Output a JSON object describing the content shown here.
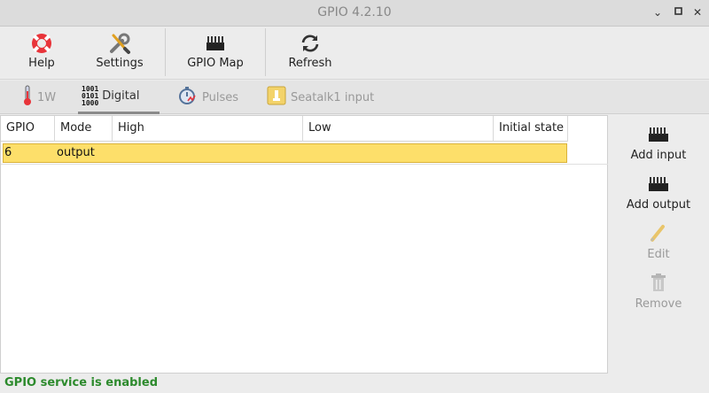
{
  "window": {
    "title": "GPIO 4.2.10"
  },
  "toolbar": {
    "help_label": "Help",
    "settings_label": "Settings",
    "gpio_map_label": "GPIO Map",
    "refresh_label": "Refresh"
  },
  "tabs": [
    {
      "label": "1W",
      "active": false,
      "icon": "thermometer-icon"
    },
    {
      "label": "Digital",
      "active": true,
      "icon": "binary-icon"
    },
    {
      "label": "Pulses",
      "active": false,
      "icon": "stopwatch-icon"
    },
    {
      "label": "Seatalk1 input",
      "active": false,
      "icon": "seatalk-icon"
    }
  ],
  "table": {
    "columns": [
      "GPIO",
      "Mode",
      "High",
      "Low",
      "Initial state"
    ],
    "rows": [
      {
        "gpio": "6",
        "mode": "output",
        "high": "",
        "low": "",
        "initial_state": ""
      }
    ]
  },
  "side": {
    "add_input_label": "Add input",
    "add_output_label": "Add output",
    "edit_label": "Edit",
    "remove_label": "Remove"
  },
  "status": {
    "text": "GPIO service is enabled",
    "color": "#2c8a2c"
  },
  "colors": {
    "selected_row": "#fddf6a",
    "accent_red": "#e8343a"
  }
}
